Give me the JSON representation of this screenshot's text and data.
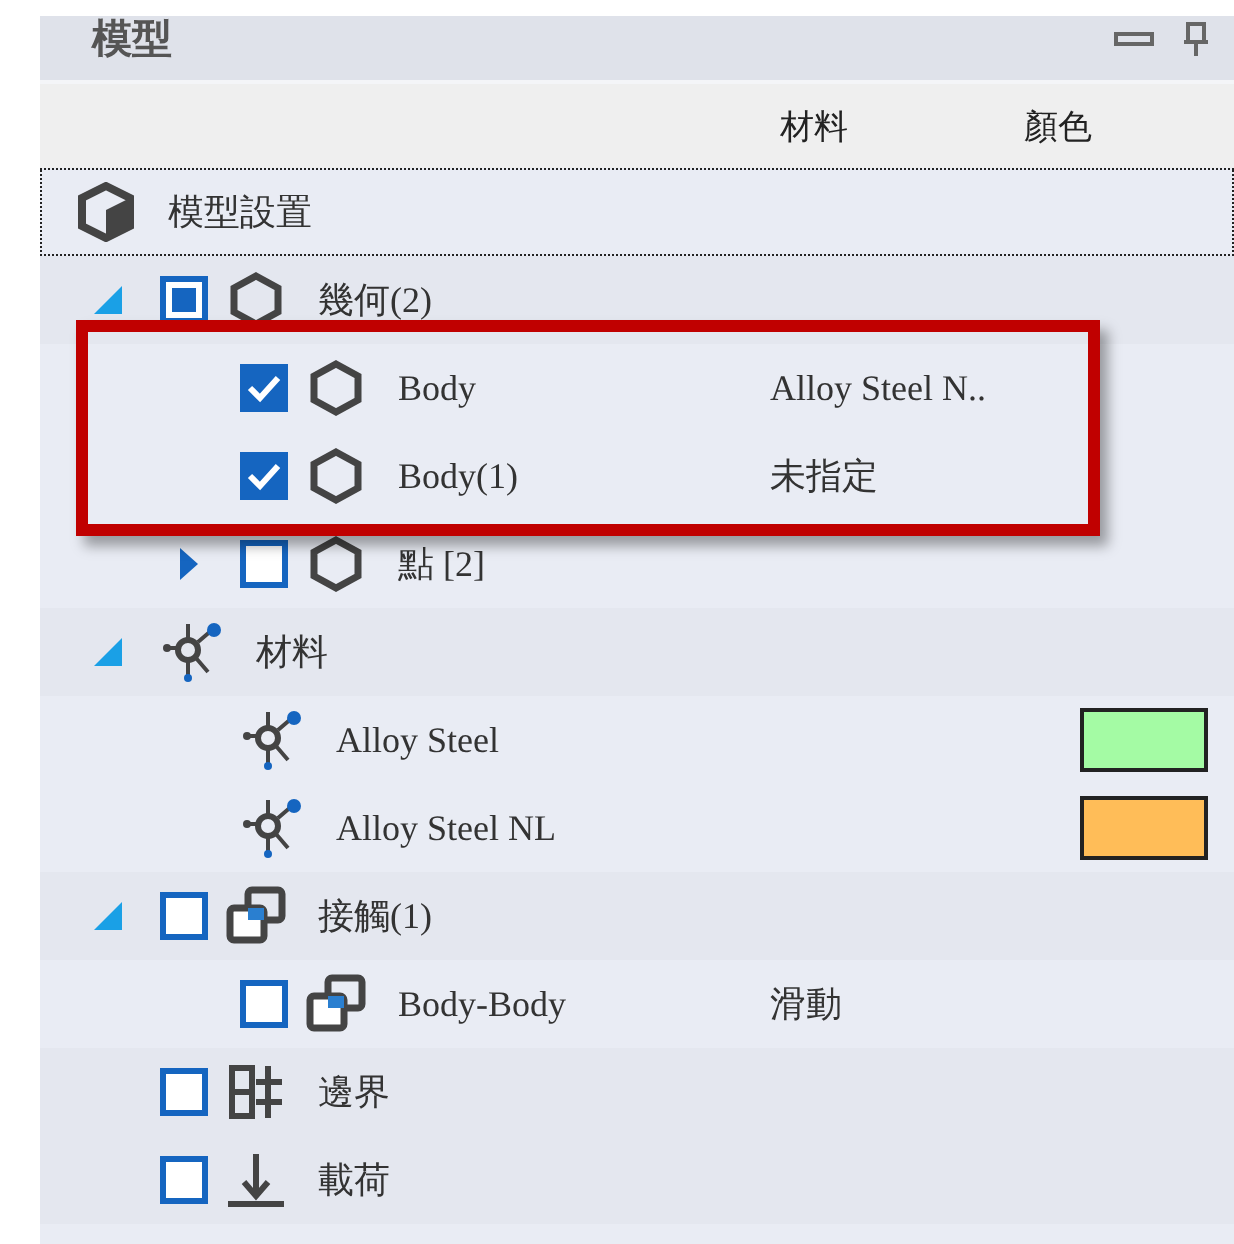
{
  "panel": {
    "title": "模型"
  },
  "columns": [
    "材料",
    "顏色"
  ],
  "tree": {
    "label": "模型設置",
    "selected": true,
    "children": [
      {
        "label": "幾何(2)",
        "kind": "body",
        "selected": false,
        "checked": false,
        "partial": true,
        "expanded": true,
        "children": [
          {
            "label": "Body",
            "kind": "body",
            "selected": false,
            "checked": true,
            "material": "Alloy Steel N.."
          },
          {
            "label": "Body(1)",
            "kind": "body",
            "selected": false,
            "checked": true,
            "material": "未指定"
          },
          {
            "label": "點 [2]",
            "kind": "body",
            "selected": false,
            "checked": false,
            "expanded": false
          }
        ]
      },
      {
        "label": "材料",
        "kind": "material",
        "selected": false,
        "expanded": true,
        "children": [
          {
            "label": "Alloy Steel",
            "kind": "material",
            "selected": false,
            "color": "#a4fba4"
          },
          {
            "label": "Alloy Steel NL",
            "kind": "material",
            "selected": false,
            "color": "#ffbd58"
          }
        ]
      },
      {
        "label": "接觸(1)",
        "kind": "contact",
        "selected": false,
        "checked": false,
        "expanded": true,
        "children": [
          {
            "label": "Body-Body",
            "kind": "contact",
            "selected": false,
            "checked": false,
            "material": "滑動"
          }
        ]
      },
      {
        "label": "邊界",
        "kind": "boundary",
        "selected": false,
        "checked": false
      },
      {
        "label": "載荷",
        "kind": "load",
        "selected": false,
        "checked": false
      }
    ]
  }
}
